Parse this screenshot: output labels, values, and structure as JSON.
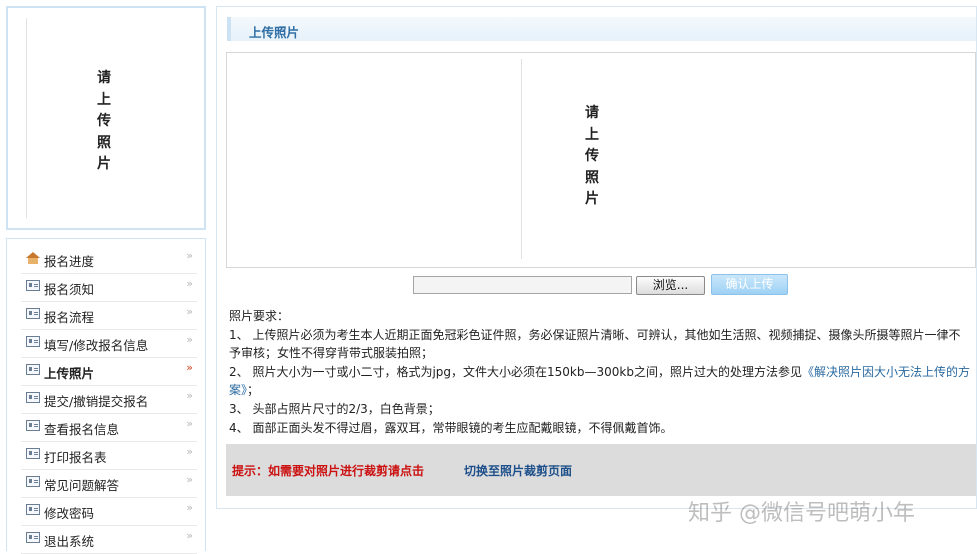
{
  "photo_placeholder": {
    "chars": [
      "请",
      "上",
      "传",
      "照",
      "片"
    ]
  },
  "menu": {
    "items": [
      {
        "label": "报名进度",
        "icon": "home-icon"
      },
      {
        "label": "报名须知",
        "icon": "card-icon"
      },
      {
        "label": "报名流程",
        "icon": "card-icon"
      },
      {
        "label": "填写/修改报名信息",
        "icon": "card-icon"
      },
      {
        "label": "上传照片",
        "icon": "card-icon",
        "active": true
      },
      {
        "label": "提交/撤销提交报名",
        "icon": "doc-icon"
      },
      {
        "label": "查看报名信息",
        "icon": "doc-icon"
      },
      {
        "label": "打印报名表",
        "icon": "card-icon"
      },
      {
        "label": "常见问题解答",
        "icon": "card-icon"
      },
      {
        "label": "修改密码",
        "icon": "card-icon"
      },
      {
        "label": "退出系统",
        "icon": "card-icon"
      }
    ]
  },
  "panel": {
    "title": "上传照片",
    "preview_chars": [
      "请",
      "上",
      "传",
      "照",
      "片"
    ],
    "browse_label": "浏览...",
    "confirm_label": "确认上传",
    "requirements": {
      "heading": "照片要求：",
      "item1": "1、  上传照片必须为考生本人近期正面免冠彩色证件照，务必保证照片清晰、可辨认，其他如生活照、视频捕捉、摄像头所摄等照片一律不予审核；女性不得穿背带式服装拍照；",
      "item2_text": "2、  照片大小为一寸或小二寸，格式为jpg，文件大小必须在150kb—300kb之间，照片过大的处理方法参见",
      "item2_link": "《解决照片因大小无法上传的方案》",
      "item2_tail": "；",
      "item3": "3、  头部占照片尺寸的2/3，白色背景；",
      "item4": "4、  面部正面头发不得过眉，露双耳，常带眼镜的考生应配戴眼镜，不得佩戴首饰。"
    },
    "notice": {
      "text": "提示：如需要对照片进行裁剪请点击",
      "link": "切换至照片裁剪页面"
    }
  },
  "watermark": "知乎 @微信号吧萌小年",
  "colors": {
    "notice_red": "#cc1111",
    "link_blue": "#1d4f8a",
    "confirm_bg": "#9ed1f4"
  }
}
